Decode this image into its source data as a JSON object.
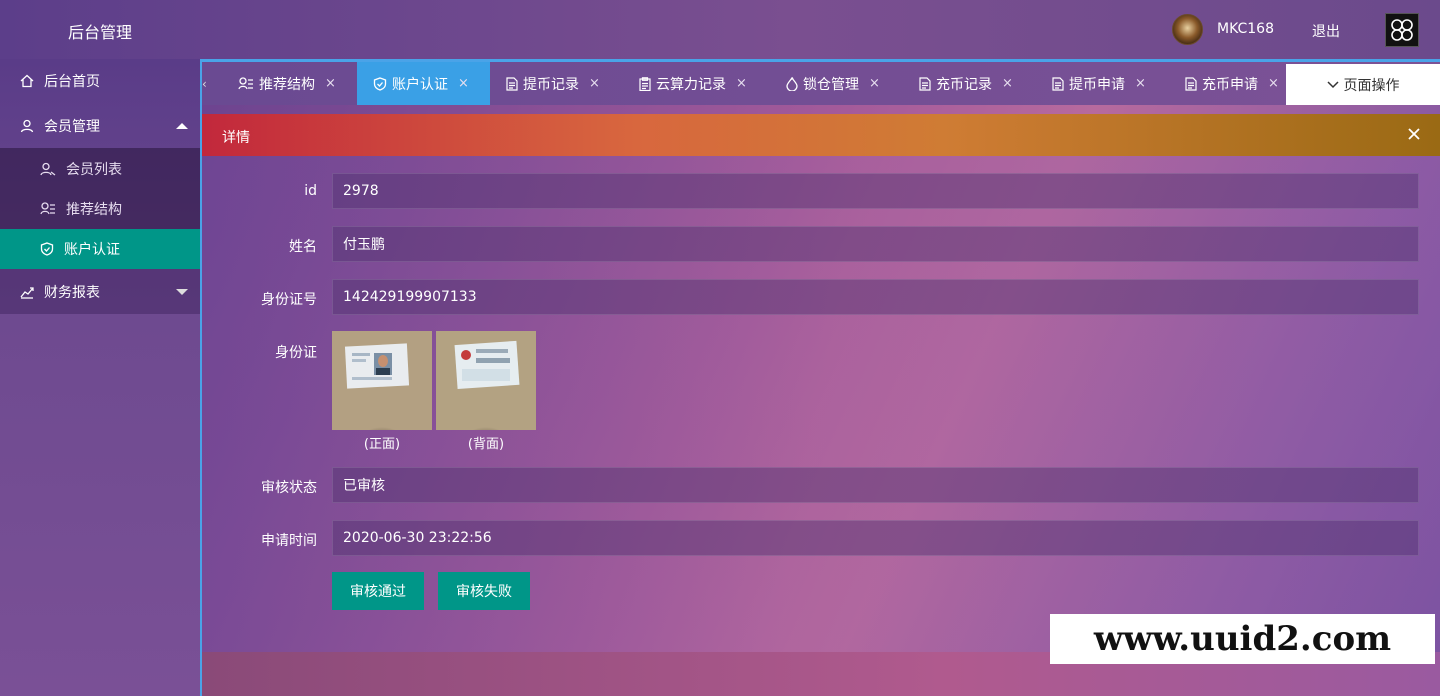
{
  "header": {
    "title": "后台管理",
    "user_name": "MKC168",
    "logout_label": "退出"
  },
  "sidebar": {
    "items": [
      {
        "label": "后台首页",
        "icon": "home-icon"
      },
      {
        "label": "会员管理",
        "icon": "user-icon",
        "expanded": true,
        "children": [
          {
            "label": "会员列表",
            "icon": "user-list-icon"
          },
          {
            "label": "推荐结构",
            "icon": "referral-icon"
          },
          {
            "label": "账户认证",
            "icon": "shield-check-icon",
            "active": true
          }
        ]
      },
      {
        "label": "财务报表",
        "icon": "finance-chart-icon",
        "expanded": false
      }
    ]
  },
  "tabs": [
    {
      "label": "推荐结构",
      "icon": "referral-icon"
    },
    {
      "label": "账户认证",
      "icon": "shield-check-icon",
      "active": true
    },
    {
      "label": "提币记录",
      "icon": "document-icon"
    },
    {
      "label": "云算力记录",
      "icon": "clipboard-icon"
    },
    {
      "label": "锁仓管理",
      "icon": "drop-icon"
    },
    {
      "label": "充币记录",
      "icon": "document-icon"
    },
    {
      "label": "提币申请",
      "icon": "document-icon"
    },
    {
      "label": "充币申请",
      "icon": "document-icon"
    }
  ],
  "tab_close_glyph": "×",
  "tab_prev_glyph": "‹",
  "page_ops_label": "页面操作",
  "detail": {
    "title": "详情",
    "fields": {
      "id": {
        "label": "id",
        "value": "2978"
      },
      "name": {
        "label": "姓名",
        "value": "付玉鹏"
      },
      "idno": {
        "label": "身份证号",
        "value": "142429199907133"
      },
      "idcard": {
        "label": "身份证",
        "front_caption": "(正面)",
        "back_caption": "(背面)"
      },
      "status": {
        "label": "审核状态",
        "value": "已审核"
      },
      "time": {
        "label": "申请时间",
        "value": "2020-06-30 23:22:56"
      }
    },
    "approve_label": "审核通过",
    "reject_label": "审核失败"
  },
  "watermark": "www.uuid2.com",
  "colors": {
    "accent_teal": "#009688",
    "active_tab_blue": "#3aa0e6"
  }
}
